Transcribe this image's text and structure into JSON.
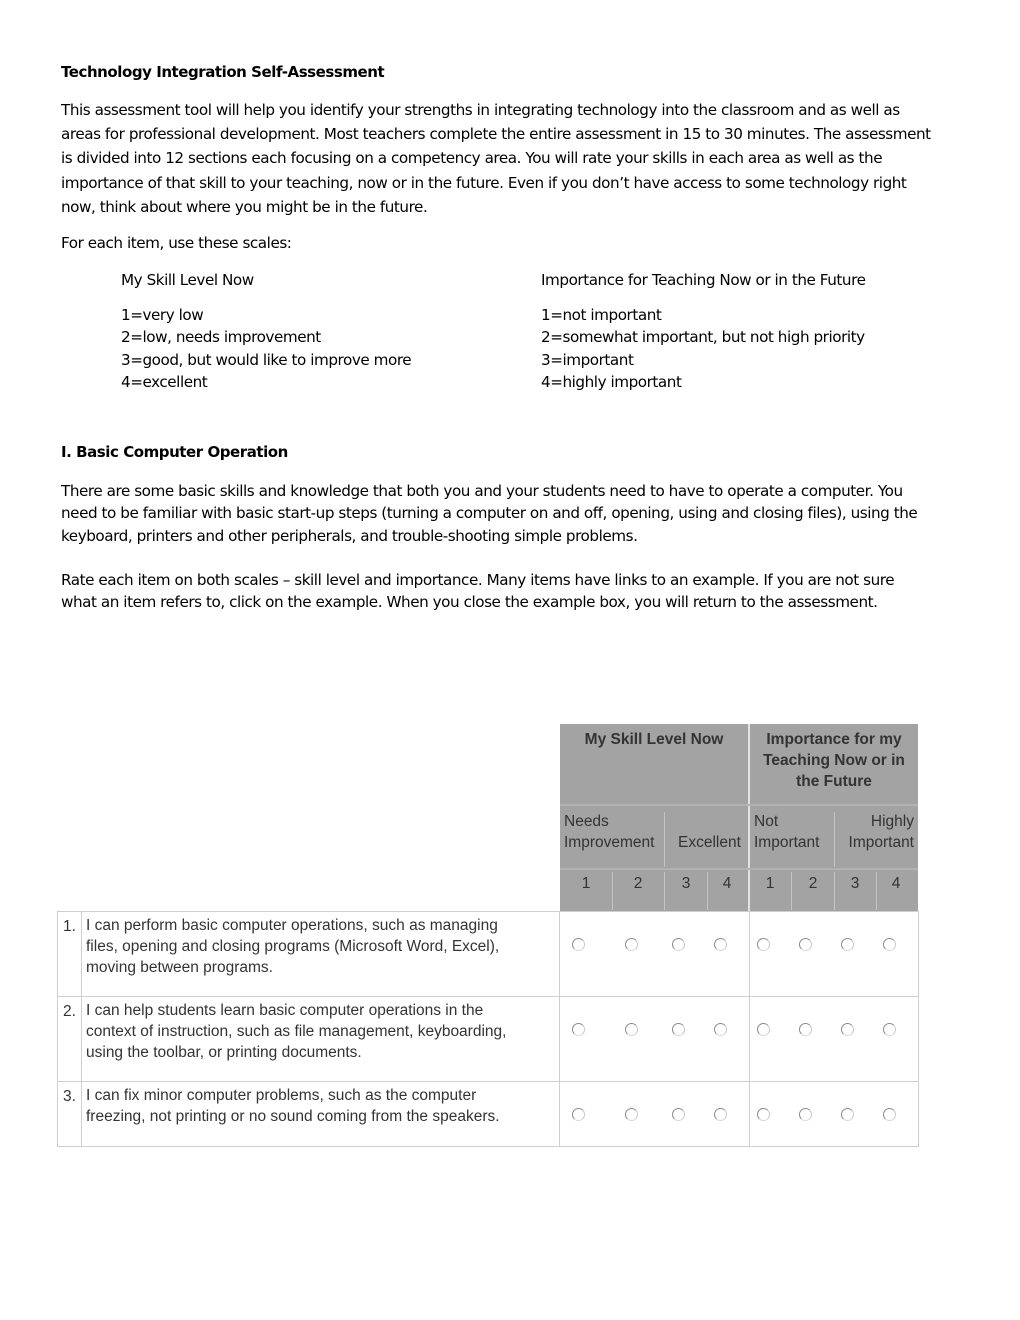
{
  "document": {
    "title": "Technology Integration Self-Assessment",
    "intro_lines": [
      "This assessment tool will help you identify your strengths in integrating technology into the classroom and as well as",
      "areas for professional development. Most teachers complete the entire assessment in 15 to 30 minutes. The assessment",
      "is divided into 12 sections each focusing on a competency area. You will rate your skills in each area as well as the",
      "importance of that skill to your teaching, now or in the future. Even if you don’t have access to some technology right",
      "now, think about where you might be in the future."
    ],
    "scales_intro": "For each item, use these scales:",
    "scales": {
      "skill": {
        "heading": "My Skill Level Now",
        "items": [
          "1=very low",
          "2=low, needs improvement",
          "3=good, but would like to improve more",
          "4=excellent"
        ]
      },
      "importance": {
        "heading": "Importance for Teaching Now or in the Future",
        "items": [
          "1=not important",
          "2=somewhat important, but not high priority",
          "3=important",
          "4=highly important"
        ]
      }
    },
    "section": {
      "heading": "I. Basic Computer Operation",
      "description_lines": [
        "There are some basic skills and knowledge that both you and your students need to have to operate a computer. You",
        "need to be familiar with basic start-up steps (turning a computer on and off, opening, using and closing files), using the",
        "keyboard, printers and other peripherals, and trouble-shooting simple problems."
      ],
      "instructions_lines": [
        "Rate each item on both scales – skill level and importance. Many items have links to an example. If you are not sure",
        "what an item refers to, click on the example. When you close the example box, you will return to the assessment."
      ]
    }
  },
  "table": {
    "skill_header": "My Skill Level Now",
    "importance_header_lines": [
      "Importance for my",
      "Teaching Now or in",
      "the Future"
    ],
    "skill_low_lines": [
      "Needs",
      "Improvement"
    ],
    "skill_high": "Excellent",
    "importance_low_lines": [
      "Not",
      "Important"
    ],
    "importance_high_lines": [
      "Highly",
      "Important"
    ],
    "rating_numbers": [
      "1",
      "2",
      "3",
      "4"
    ],
    "items": [
      {
        "number": "1.",
        "text_lines": [
          "I can perform basic computer operations, such as managing",
          "files, opening and closing programs (Microsoft Word, Excel),",
          "moving between programs."
        ],
        "skill_selected": null,
        "importance_selected": null
      },
      {
        "number": "2.",
        "text_lines": [
          "I can help students learn basic computer operations in the",
          "context of instruction, such as file management, keyboarding,",
          "using the toolbar, or printing documents."
        ],
        "skill_selected": null,
        "importance_selected": null
      },
      {
        "number": "3.",
        "text_lines": [
          "I can fix minor computer problems, such as the computer",
          "freezing, not printing or no sound coming from the speakers."
        ],
        "skill_selected": null,
        "importance_selected": null
      }
    ]
  }
}
